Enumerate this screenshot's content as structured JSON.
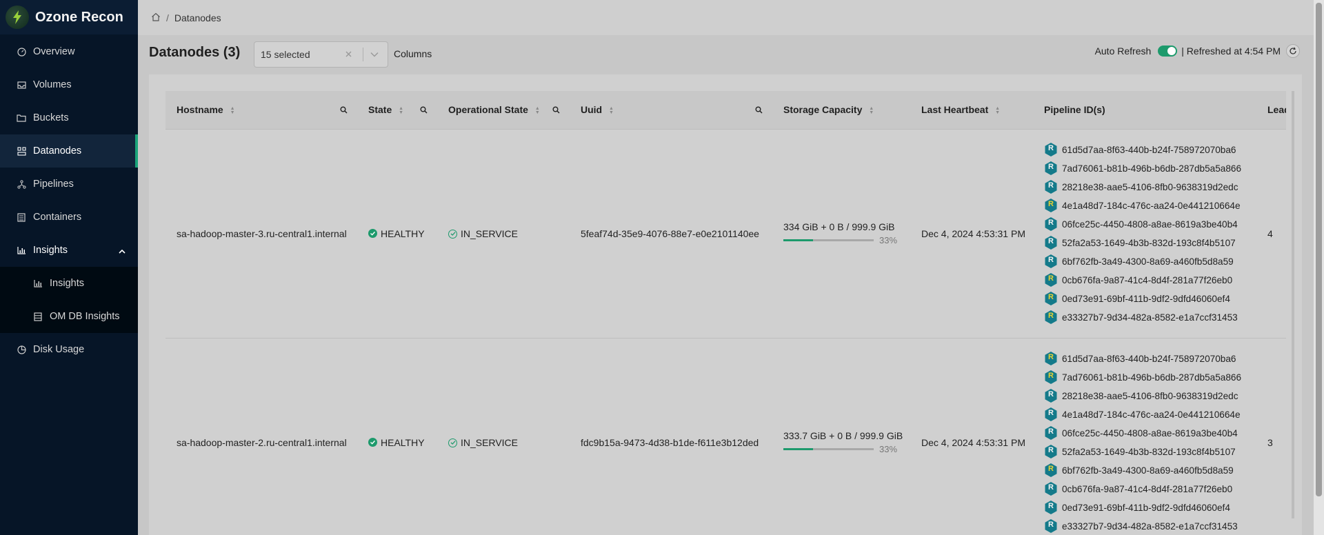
{
  "app": {
    "title": "Ozone Recon"
  },
  "sidebar": {
    "items": [
      {
        "label": "Overview",
        "icon": "dashboard-icon"
      },
      {
        "label": "Volumes",
        "icon": "inbox-icon"
      },
      {
        "label": "Buckets",
        "icon": "folder-icon"
      },
      {
        "label": "Datanodes",
        "icon": "cluster-icon",
        "active": true
      },
      {
        "label": "Pipelines",
        "icon": "deployment-icon"
      },
      {
        "label": "Containers",
        "icon": "container-icon"
      },
      {
        "label": "Insights",
        "icon": "bar-chart-icon",
        "expanded": true
      },
      {
        "label": "Insights",
        "icon": "bar-chart-icon",
        "sub": true
      },
      {
        "label": "OM DB Insights",
        "icon": "database-icon",
        "sub": true
      },
      {
        "label": "Disk Usage",
        "icon": "pie-chart-icon"
      }
    ]
  },
  "breadcrumb": {
    "current": "Datanodes"
  },
  "page": {
    "title": "Datanodes (3)",
    "select_value": "15 selected",
    "columns_label": "Columns",
    "auto_refresh_label": "Auto Refresh",
    "refreshed_text": "| Refreshed at 4:54 PM"
  },
  "colors": {
    "accent": "#1d9a6c",
    "sidebar_bg": "#061527"
  },
  "table": {
    "columns": [
      "Hostname",
      "State",
      "Operational State",
      "Uuid",
      "Storage Capacity",
      "Last Heartbeat",
      "Pipeline ID(s)",
      "Leader"
    ],
    "rows": [
      {
        "hostname": "sa-hadoop-master-3.ru-central1.internal",
        "state": "HEALTHY",
        "op_state": "IN_SERVICE",
        "uuid": "5feaf74d-35e9-4076-88e7-e0e2101140ee",
        "capacity": "334 GiB + 0 B / 999.9 GiB",
        "percent": 33,
        "percent_text": "33%",
        "heartbeat": "Dec 4, 2024 4:53:31 PM",
        "leader": "4",
        "pipelines": [
          {
            "id": "61d5d7aa-8f63-440b-b24f-758972070ba6",
            "leader": false
          },
          {
            "id": "7ad76061-b81b-496b-b6db-287db5a5a866",
            "leader": false
          },
          {
            "id": "28218e38-aae5-4106-8fb0-9638319d2edc",
            "leader": false
          },
          {
            "id": "4e1a48d7-184c-476c-aa24-0e441210664e",
            "leader": true
          },
          {
            "id": "06fce25c-4450-4808-a8ae-8619a3be40b4",
            "leader": false
          },
          {
            "id": "52fa2a53-1649-4b3b-832d-193c8f4b5107",
            "leader": false
          },
          {
            "id": "6bf762fb-3a49-4300-8a69-a460fb5d8a59",
            "leader": false
          },
          {
            "id": "0cb676fa-9a87-41c4-8d4f-281a77f26eb0",
            "leader": true
          },
          {
            "id": "0ed73e91-69bf-411b-9df2-9dfd46060ef4",
            "leader": true
          },
          {
            "id": "e33327b7-9d34-482a-8582-e1a7ccf31453",
            "leader": true
          }
        ]
      },
      {
        "hostname": "sa-hadoop-master-2.ru-central1.internal",
        "state": "HEALTHY",
        "op_state": "IN_SERVICE",
        "uuid": "fdc9b15a-9473-4d38-b1de-f611e3b12ded",
        "capacity": "333.7 GiB + 0 B / 999.9 GiB",
        "percent": 33,
        "percent_text": "33%",
        "heartbeat": "Dec 4, 2024 4:53:31 PM",
        "leader": "3",
        "pipelines": [
          {
            "id": "61d5d7aa-8f63-440b-b24f-758972070ba6",
            "leader": true
          },
          {
            "id": "7ad76061-b81b-496b-b6db-287db5a5a866",
            "leader": true
          },
          {
            "id": "28218e38-aae5-4106-8fb0-9638319d2edc",
            "leader": false
          },
          {
            "id": "4e1a48d7-184c-476c-aa24-0e441210664e",
            "leader": false
          },
          {
            "id": "06fce25c-4450-4808-a8ae-8619a3be40b4",
            "leader": false
          },
          {
            "id": "52fa2a53-1649-4b3b-832d-193c8f4b5107",
            "leader": false
          },
          {
            "id": "6bf762fb-3a49-4300-8a69-a460fb5d8a59",
            "leader": true
          },
          {
            "id": "0cb676fa-9a87-41c4-8d4f-281a77f26eb0",
            "leader": false
          },
          {
            "id": "0ed73e91-69bf-411b-9df2-9dfd46060ef4",
            "leader": false
          },
          {
            "id": "e33327b7-9d34-482a-8582-e1a7ccf31453",
            "leader": false
          }
        ]
      }
    ]
  }
}
